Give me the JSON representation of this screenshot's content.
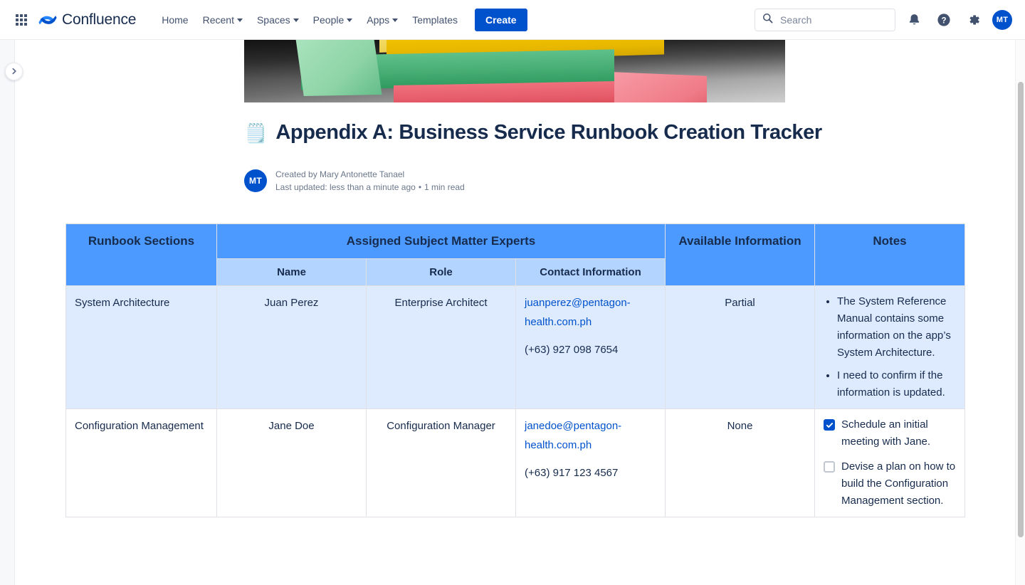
{
  "nav": {
    "app_switcher_icon": "grid-icon",
    "brand": "Confluence",
    "items": [
      {
        "label": "Home",
        "has_caret": false
      },
      {
        "label": "Recent",
        "has_caret": true
      },
      {
        "label": "Spaces",
        "has_caret": true
      },
      {
        "label": "People",
        "has_caret": true
      },
      {
        "label": "Apps",
        "has_caret": true
      },
      {
        "label": "Templates",
        "has_caret": false
      }
    ],
    "create_label": "Create",
    "search_placeholder": "Search",
    "search_value": "",
    "notifications_icon": "notification-bell-icon",
    "help_icon": "help-circle-icon",
    "settings_icon": "gear-icon",
    "avatar_initials": "MT"
  },
  "sidebar": {
    "expand_icon": "chevron-right-icon"
  },
  "page": {
    "cover_alt": "stacked sticky note pads",
    "title_emoji": "🗒️",
    "title": "Appendix A: Business Service Runbook Creation Tracker",
    "author_initials": "MT",
    "created_by": "Created by Mary Antonette Tanael",
    "last_updated": "Last updated: less than a minute ago",
    "separator": "•",
    "read_time": "1 min read"
  },
  "table": {
    "headers": {
      "sections": "Runbook Sections",
      "smes": "Assigned Subject Matter Experts",
      "name": "Name",
      "role": "Role",
      "contact": "Contact Information",
      "available": "Available Information",
      "notes": "Notes"
    },
    "rows": [
      {
        "highlight": true,
        "section": "System Architecture",
        "name": "Juan Perez",
        "role": "Enterprise Architect",
        "email": "juanperez@pentagon-health.com.ph",
        "phone": "(+63) 927 098 7654",
        "available": "Partial",
        "notes_type": "bullets",
        "bullets": [
          "The System Reference Manual contains some information on the app’s System Architecture.",
          "I need to confirm if the information is updated."
        ]
      },
      {
        "highlight": false,
        "section": "Configuration Management",
        "name": "Jane Doe",
        "role": "Configuration Manager",
        "email": "janedoe@pentagon-health.com.ph",
        "phone": "(+63) 917 123 4567",
        "available": "None",
        "notes_type": "tasks",
        "tasks": [
          {
            "checked": true,
            "label": "Schedule an initial meeting with Jane."
          },
          {
            "checked": false,
            "label": "Devise a plan on how to build the Configuration Management section."
          }
        ]
      }
    ]
  },
  "colors": {
    "brand_blue": "#0052CC",
    "header_blue": "#4C9AFF",
    "subheader_blue": "#B3D4FF",
    "row_highlight": "#DEEBFF",
    "link_blue": "#0052CC",
    "text": "#172B4D"
  }
}
